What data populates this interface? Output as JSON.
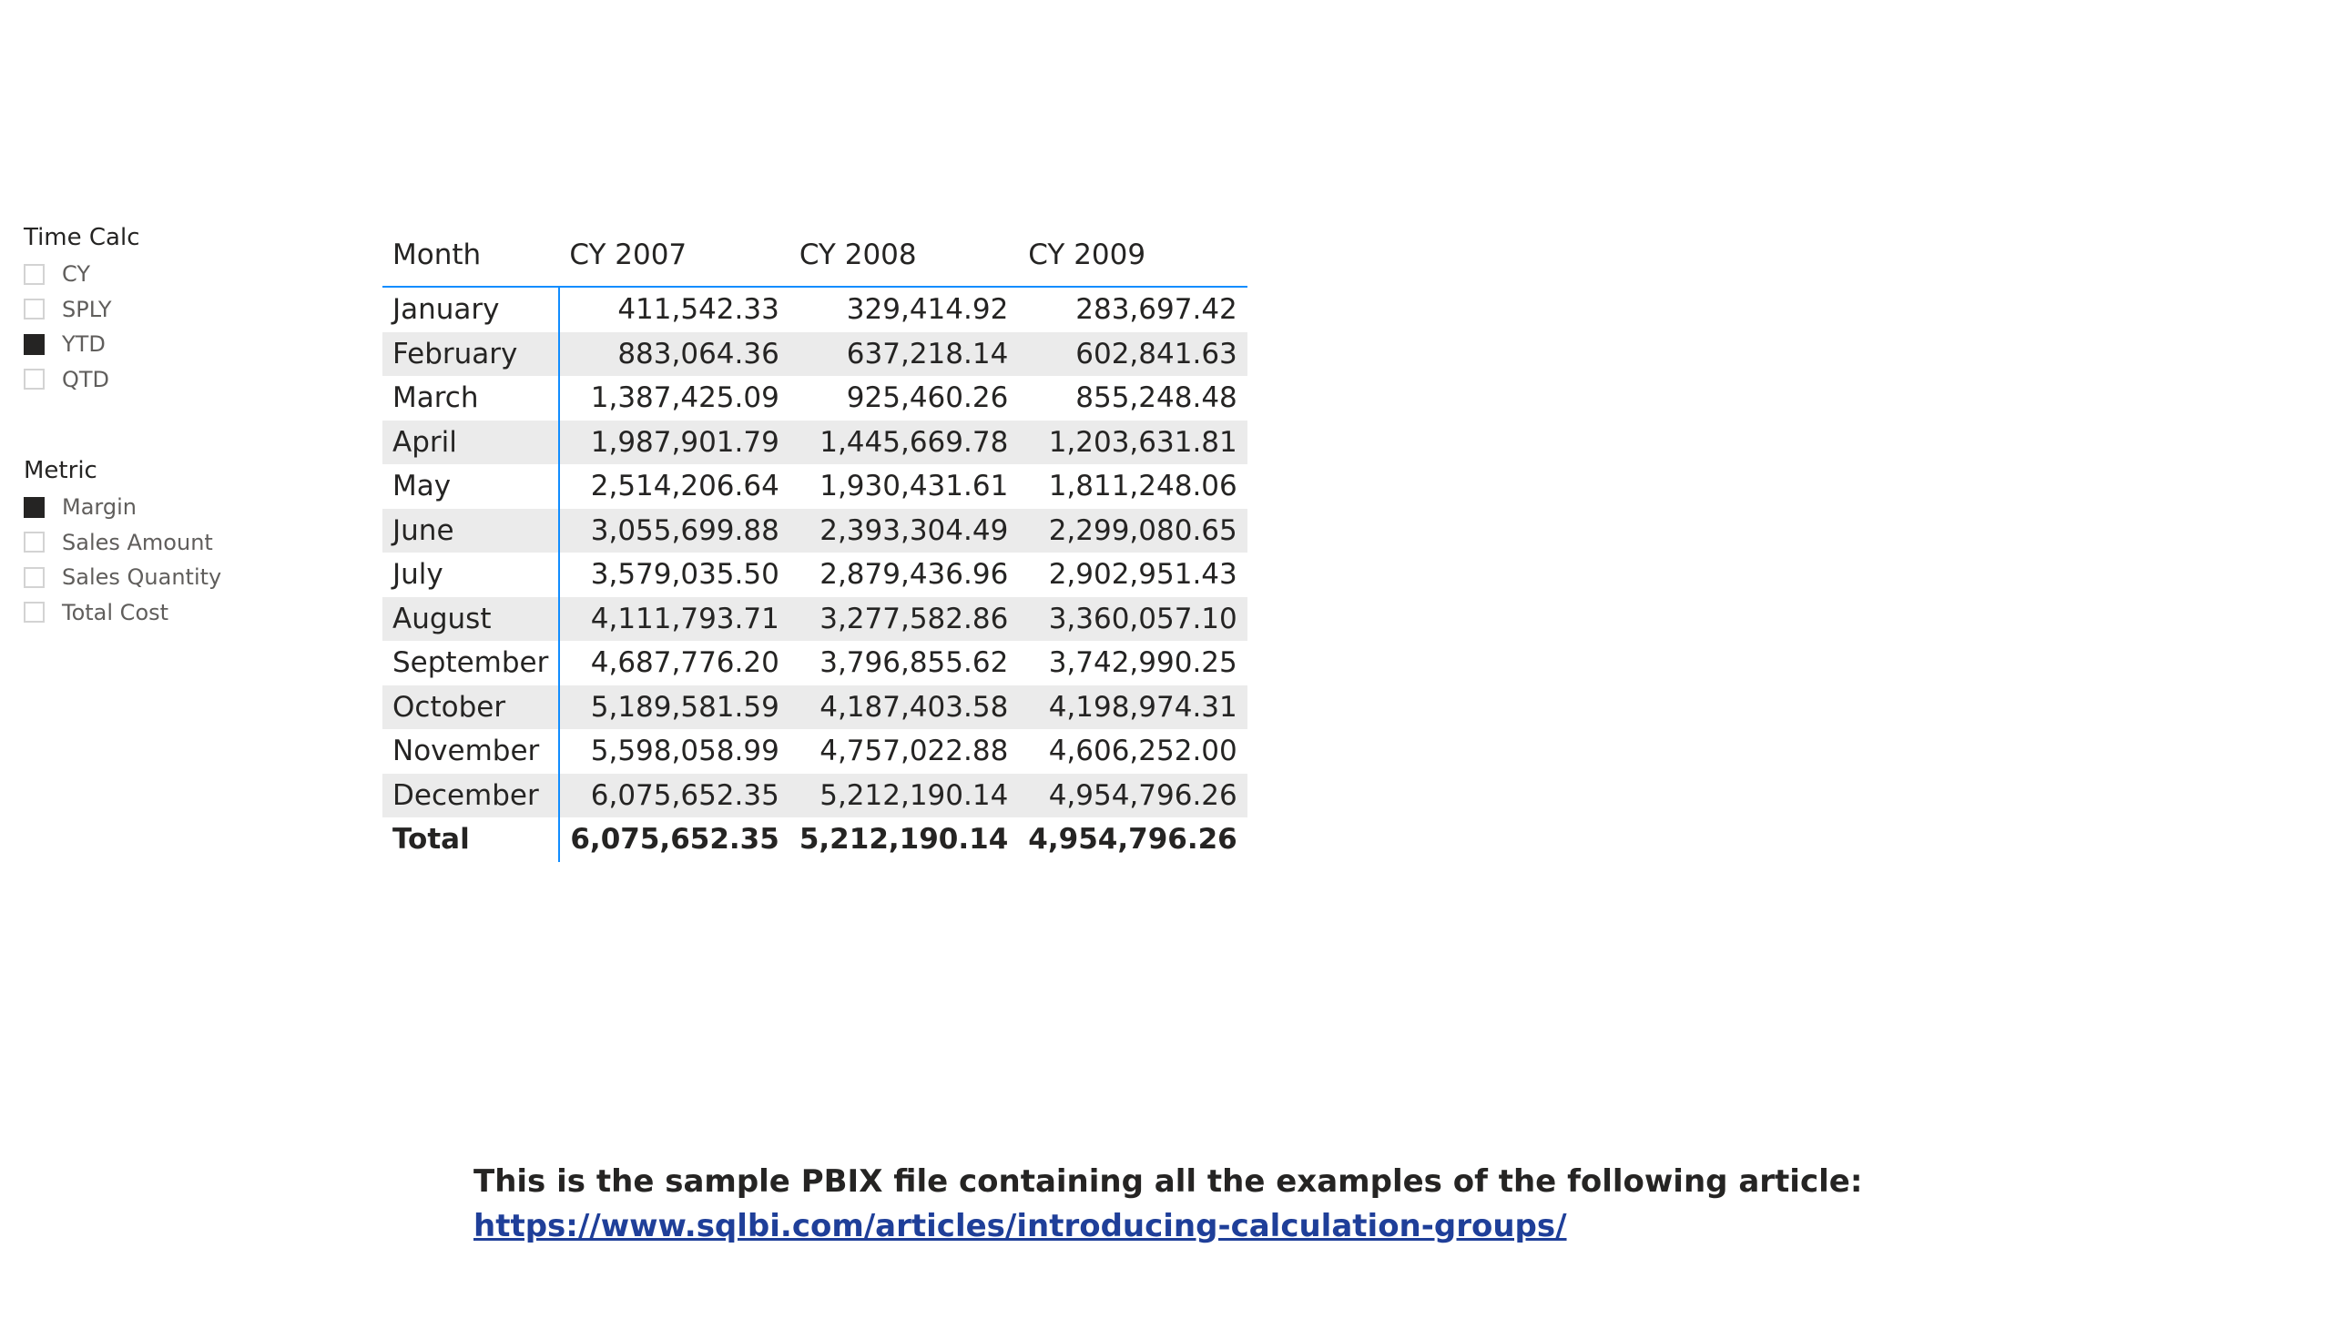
{
  "slicers": {
    "time_calc": {
      "title": "Time Calc",
      "items": [
        {
          "label": "CY",
          "checked": false
        },
        {
          "label": "SPLY",
          "checked": false
        },
        {
          "label": "YTD",
          "checked": true
        },
        {
          "label": "QTD",
          "checked": false
        }
      ]
    },
    "metric": {
      "title": "Metric",
      "items": [
        {
          "label": "Margin",
          "checked": true
        },
        {
          "label": "Sales Amount",
          "checked": false
        },
        {
          "label": "Sales Quantity",
          "checked": false
        },
        {
          "label": "Total Cost",
          "checked": false
        }
      ]
    }
  },
  "matrix": {
    "headers": [
      "Month",
      "CY 2007",
      "CY 2008",
      "CY 2009"
    ],
    "rows": [
      {
        "label": "January",
        "values": [
          "411,542.33",
          "329,414.92",
          "283,697.42"
        ]
      },
      {
        "label": "February",
        "values": [
          "883,064.36",
          "637,218.14",
          "602,841.63"
        ]
      },
      {
        "label": "March",
        "values": [
          "1,387,425.09",
          "925,460.26",
          "855,248.48"
        ]
      },
      {
        "label": "April",
        "values": [
          "1,987,901.79",
          "1,445,669.78",
          "1,203,631.81"
        ]
      },
      {
        "label": "May",
        "values": [
          "2,514,206.64",
          "1,930,431.61",
          "1,811,248.06"
        ]
      },
      {
        "label": "June",
        "values": [
          "3,055,699.88",
          "2,393,304.49",
          "2,299,080.65"
        ]
      },
      {
        "label": "July",
        "values": [
          "3,579,035.50",
          "2,879,436.96",
          "2,902,951.43"
        ]
      },
      {
        "label": "August",
        "values": [
          "4,111,793.71",
          "3,277,582.86",
          "3,360,057.10"
        ]
      },
      {
        "label": "September",
        "values": [
          "4,687,776.20",
          "3,796,855.62",
          "3,742,990.25"
        ]
      },
      {
        "label": "October",
        "values": [
          "5,189,581.59",
          "4,187,403.58",
          "4,198,974.31"
        ]
      },
      {
        "label": "November",
        "values": [
          "5,598,058.99",
          "4,757,022.88",
          "4,606,252.00"
        ]
      },
      {
        "label": "December",
        "values": [
          "6,075,652.35",
          "5,212,190.14",
          "4,954,796.26"
        ]
      }
    ],
    "total": {
      "label": "Total",
      "values": [
        "6,075,652.35",
        "5,212,190.14",
        "4,954,796.26"
      ]
    }
  },
  "footnote": {
    "text": "This is the sample PBIX file containing all the examples of the following article:",
    "link": "https://www.sqlbi.com/articles/introducing-calculation-groups/"
  },
  "colors": {
    "accent": "#118dff",
    "row_band": "#ebebeb",
    "checkbox_checked": "#252423",
    "link": "#1f3f99"
  }
}
